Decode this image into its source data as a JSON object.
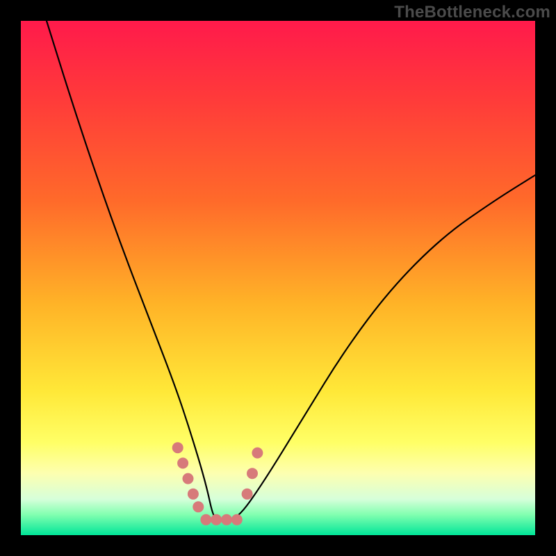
{
  "watermark": "TheBottleneck.com",
  "gradient": {
    "stops": [
      {
        "offset": 0,
        "color": "#ff1a4b"
      },
      {
        "offset": 0.15,
        "color": "#ff3a3a"
      },
      {
        "offset": 0.35,
        "color": "#ff6a2a"
      },
      {
        "offset": 0.55,
        "color": "#ffb327"
      },
      {
        "offset": 0.72,
        "color": "#ffe838"
      },
      {
        "offset": 0.82,
        "color": "#ffff66"
      },
      {
        "offset": 0.88,
        "color": "#fdffb0"
      },
      {
        "offset": 0.93,
        "color": "#d6ffda"
      },
      {
        "offset": 0.96,
        "color": "#82ffb0"
      },
      {
        "offset": 1.0,
        "color": "#00e598"
      }
    ]
  },
  "chart_data": {
    "type": "line",
    "title": "",
    "xlabel": "",
    "ylabel": "",
    "xlim": [
      0,
      100
    ],
    "ylim": [
      0,
      100
    ],
    "series": [
      {
        "name": "curve",
        "x": [
          5,
          10,
          15,
          20,
          25,
          30,
          33,
          36,
          37.5,
          39,
          42,
          47,
          55,
          63,
          72,
          82,
          92,
          100
        ],
        "values": [
          100,
          84,
          69,
          55,
          42,
          29,
          20,
          10,
          3,
          3,
          3,
          10,
          23,
          36,
          48,
          58,
          65,
          70
        ]
      }
    ],
    "markers": {
      "color": "#d77a7a",
      "radius": 8,
      "points": [
        {
          "x": 30.5,
          "y": 17
        },
        {
          "x": 31.5,
          "y": 14
        },
        {
          "x": 32.5,
          "y": 11
        },
        {
          "x": 33.5,
          "y": 8
        },
        {
          "x": 34.5,
          "y": 5.5
        },
        {
          "x": 36,
          "y": 3
        },
        {
          "x": 38,
          "y": 3
        },
        {
          "x": 40,
          "y": 3
        },
        {
          "x": 42,
          "y": 3
        },
        {
          "x": 44,
          "y": 8
        },
        {
          "x": 45,
          "y": 12
        },
        {
          "x": 46,
          "y": 16
        }
      ]
    }
  }
}
